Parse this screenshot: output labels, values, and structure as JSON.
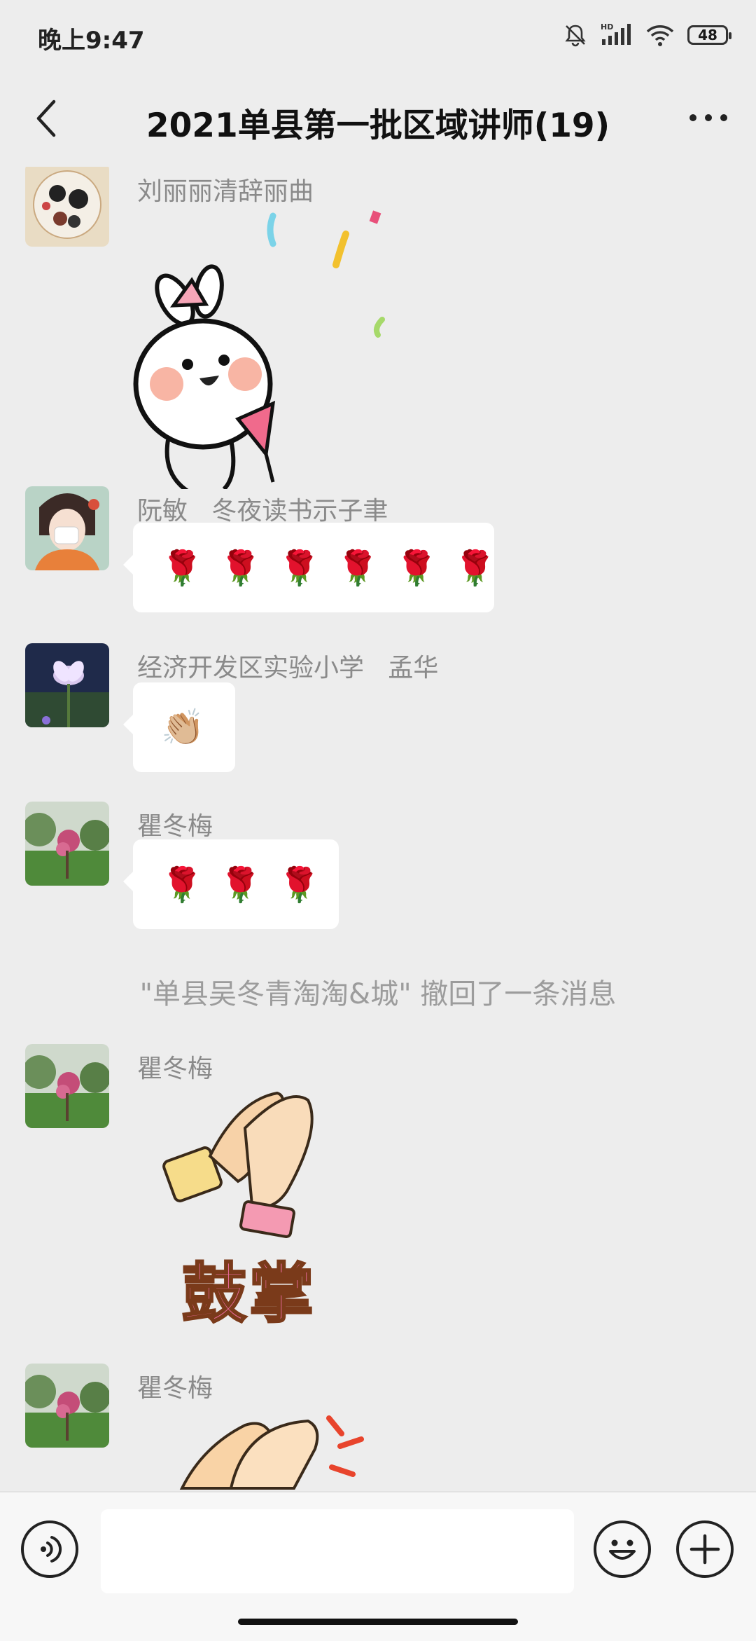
{
  "status_bar": {
    "time": "晚上9:47",
    "battery": "48",
    "network": "HD"
  },
  "header": {
    "title": "2021单县第一批区域讲师(19)"
  },
  "messages": [
    {
      "sender": "刘丽丽清辞丽曲",
      "type": "sticker",
      "sticker": "celebrating-rabbit-sticker"
    },
    {
      "sender": "阮敏   冬夜读书示子聿",
      "type": "emoji",
      "emoji": [
        "🌹",
        "🌹",
        "🌹",
        "🌹",
        "🌹",
        "🌹"
      ]
    },
    {
      "sender": "经济开发区实验小学   孟华",
      "type": "emoji",
      "emoji": [
        "👏🏼"
      ]
    },
    {
      "sender": "瞿冬梅",
      "type": "emoji",
      "emoji": [
        "🌹",
        "🌹",
        "🌹"
      ]
    },
    {
      "sender": "瞿冬梅",
      "type": "sticker",
      "sticker": "clapping-hands-sticker",
      "sticker_text": "鼓掌"
    },
    {
      "sender": "瞿冬梅",
      "type": "sticker",
      "sticker": "clapping-hands-sticker"
    }
  ],
  "recall_notice": "\"单县吴冬青淘淘&城\" 撤回了一条消息",
  "input_bar": {
    "placeholder": ""
  },
  "colors": {
    "background": "#ededed",
    "bubble": "#ffffff",
    "meta_text": "#8a8a8a"
  }
}
